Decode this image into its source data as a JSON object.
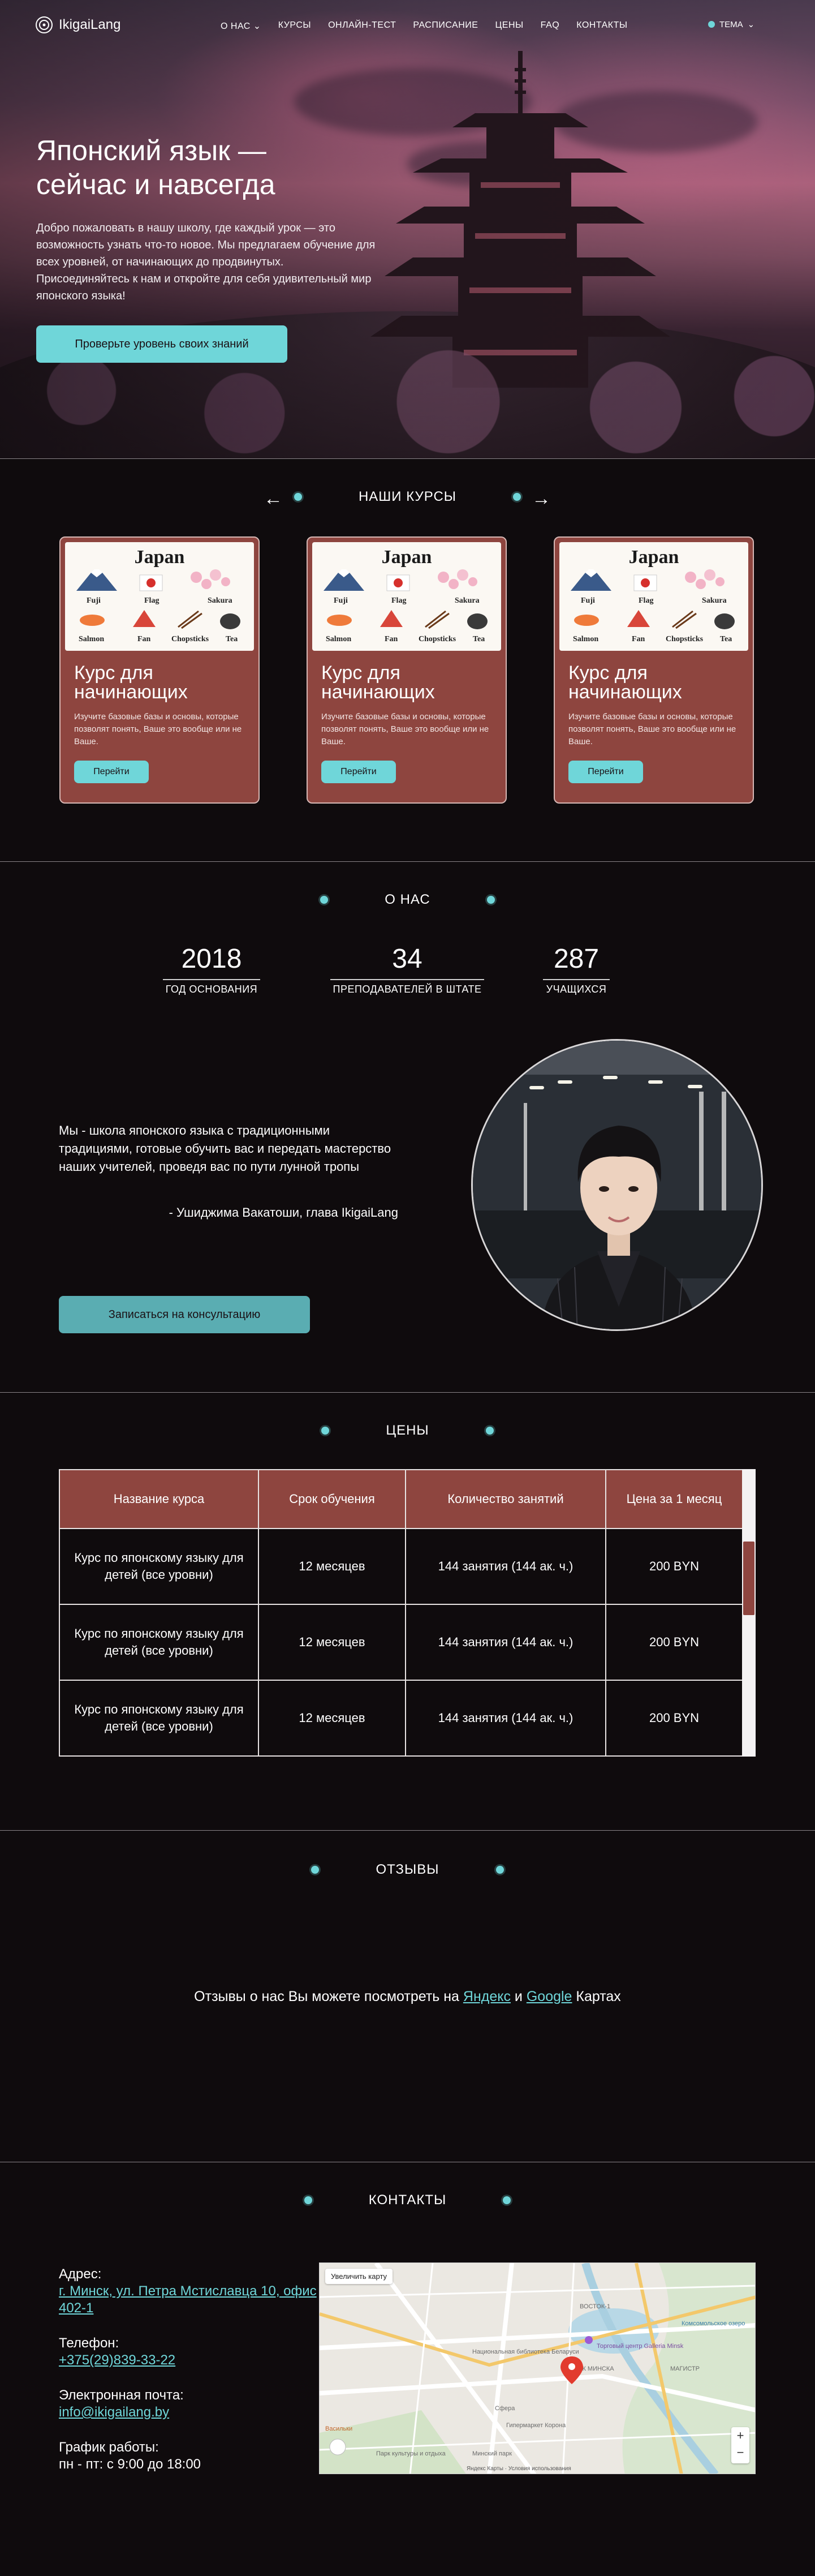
{
  "nav": {
    "logo": "IkigaiLang",
    "links": [
      "О НАС",
      "КУРСЫ",
      "ОНЛАЙН-ТЕСТ",
      "РАСПИСАНИЕ",
      "ЦЕНЫ",
      "FAQ",
      "КОНТАКТЫ"
    ],
    "theme": "ТЕМА"
  },
  "hero": {
    "title": "Японский язык — сейчас и навсегда",
    "text": "Добро пожаловать в нашу школу, где каждый урок — это возможность узнать что-то новое. Мы предлагаем обучение для всех уровней, от начинающих до продвинутых. Присоединяйтесь к нам и откройте для себя удивительный мир японского языка!",
    "button": "Проверьте уровень своих знаний"
  },
  "courses": {
    "section_title": "НАШИ КУРСЫ",
    "image_labels": {
      "title": "Japan",
      "items": [
        "Fuji",
        "Flag",
        "Sakura",
        "Salmon",
        "Fan",
        "Chopsticks",
        "Tea"
      ]
    },
    "cards": [
      {
        "title": "Курс для начинающих",
        "text": "Изучите базовые базы и основы, которые позволят понять, Ваше это вообще или не Ваше.",
        "button": "Перейти"
      },
      {
        "title": "Курс для начинающих",
        "text": "Изучите базовые базы и основы, которые позволят понять, Ваше это вообще или не Ваше.",
        "button": "Перейти"
      },
      {
        "title": "Курс для начинающих",
        "text": "Изучите базовые базы и основы, которые позволят понять, Ваше это вообще или не Ваше.",
        "button": "Перейти"
      }
    ]
  },
  "about": {
    "section_title": "О НАС",
    "stats": [
      {
        "value": "2018",
        "caption": "ГОД ОСНОВАНИЯ"
      },
      {
        "value": "34",
        "caption": "ПРЕПОДАВАТЕЛЕЙ В ШТАТЕ"
      },
      {
        "value": "287",
        "caption": "УЧАЩИХСЯ"
      }
    ],
    "text": "Мы - школа японского языка с традиционными традициями, готовые обучить вас и передать мастерство наших учителей, проведя вас по пути лунной тропы",
    "signature": "- Ушиджима Вакатоши, глава IkigaiLang",
    "button": "Записаться на консультацию"
  },
  "prices": {
    "section_title": "ЦЕНЫ",
    "headers": [
      "Название курса",
      "Срок обучения",
      "Количество занятий",
      "Цена за 1 месяц"
    ],
    "rows": [
      [
        "Курс по японскому языку для детей (все уровни)",
        "12 месяцев",
        "144 занятия (144 ак. ч.)",
        "200 BYN"
      ],
      [
        "Курс по японскому языку для детей (все уровни)",
        "12 месяцев",
        "144 занятия (144 ак. ч.)",
        "200 BYN"
      ],
      [
        "Курс по японскому языку для детей (все уровни)",
        "12 месяцев",
        "144 занятия (144 ак. ч.)",
        "200 BYN"
      ]
    ]
  },
  "reviews": {
    "section_title": "ОТЗЫВЫ",
    "text_before": "Отзывы о нас Вы можете посмотреть на ",
    "link1": "Яндекс",
    "text_middle": " и ",
    "link2": "Google",
    "text_after": " Картах"
  },
  "contacts": {
    "section_title": "КОНТАКТЫ",
    "address_label": "Адрес:",
    "address": "г. Минск, ул. Петра Мстиславца 10, офис 402-1",
    "phone_label": "Телефон:",
    "phone": "+375(29)839-33-22",
    "email_label": "Электронная почта:",
    "email": "info@ikigailang.by",
    "hours_label": "График работы:",
    "hours": "пн - пт: с 9:00 до 18:00",
    "map": {
      "enlarge": "Увеличить карту",
      "labels": [
        "ВОСТОК-1",
        "МАЯК МИНСКА",
        "Национальная библиотека Беларуси",
        "Сфера",
        "Гипермаркет Корона",
        "Торговый центр Galleria Minsk",
        "МАГИСТР",
        "Комсомольское озеро",
        "Васильки",
        "Парк культуры и отдыха",
        "Минский парк"
      ],
      "footer": "Яндекс Карты · Условия использования"
    }
  },
  "colors": {
    "accent": "#6fd6d9",
    "brand": "#8e453f",
    "background": "#0f0b0d"
  }
}
